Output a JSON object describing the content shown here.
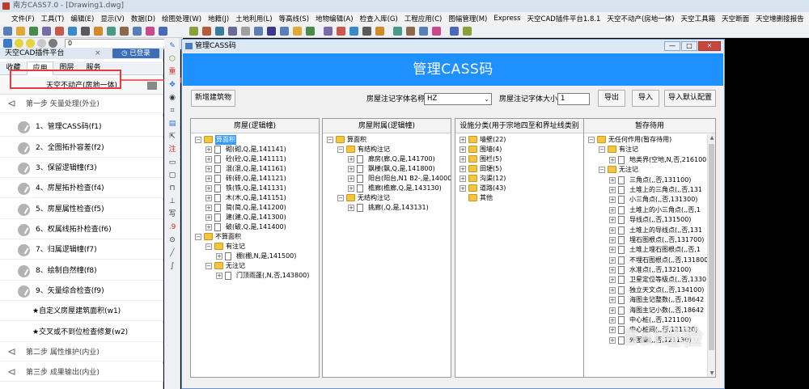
{
  "window": {
    "title": "南方CASS7.0 - [Drawing1.dwg]"
  },
  "menu": [
    "文件(F)",
    "工具(T)",
    "编辑(E)",
    "显示(V)",
    "数据(D)",
    "绘图处理(W)",
    "地籍(J)",
    "土地利用(L)",
    "等高线(S)",
    "地物编辑(A)",
    "检查入库(G)",
    "工程应用(C)",
    "图幅管理(M)",
    "Express",
    "天空CAD插件平台1.8.1",
    "天空不动产(房地一体)",
    "天空工具箱",
    "天空断面",
    "天空增删接报告"
  ],
  "toolbar2": {
    "layer_value": "0"
  },
  "left_panel": {
    "title": "天空CAD插件平台",
    "close": "×",
    "login": "已登录",
    "tabs": [
      "收藏",
      "应用",
      "图层",
      "服务"
    ],
    "active_tab": "应用",
    "subtitle": "天空不动产(房地一体)",
    "steps": [
      {
        "label": "第一步 矢量处理(外业)"
      },
      {
        "label": "第二步 属性维护(内业)"
      },
      {
        "label": "第三步 成果输出(内业)"
      }
    ],
    "items": [
      {
        "label": "1、管理CASS码(f1)"
      },
      {
        "label": "2、全图拓扑容差(f2)"
      },
      {
        "label": "3、保留逻辑幢(f3)"
      },
      {
        "label": "4、房屋拓扑检查(f4)"
      },
      {
        "label": "5、房屋属性检查(f5)"
      },
      {
        "label": "6、权属线拓扑检查(f6)"
      },
      {
        "label": "7、归属逻辑幢(f7)"
      },
      {
        "label": "8、绘制自然幢(f8)"
      },
      {
        "label": "9、矢量综合检查(f9)"
      },
      {
        "label": "★自定义房屋建筑面积(w1)"
      },
      {
        "label": "★交叉或不到位检查修复(w2)"
      }
    ]
  },
  "dialog": {
    "title": "管理CASS码",
    "banner": "管理CASS码",
    "new_building_btn": "新增建筑物",
    "font_name_label": "房屋注记字体名称:",
    "font_name_value": "HZ",
    "font_size_label": "房屋注记字体大小:",
    "font_size_value": "1",
    "export_btn": "导出",
    "import_btn": "导入",
    "import_default_btn": "导入默认配置",
    "panes": [
      {
        "header": "房屋(逻辑幢)",
        "nodes": [
          {
            "d": 0,
            "e": "−",
            "i": "folder",
            "t": "算面积",
            "sel": true
          },
          {
            "d": 1,
            "e": "+",
            "i": "doc",
            "t": "砌(砌,Q,是,141141)"
          },
          {
            "d": 1,
            "e": "+",
            "i": "doc",
            "t": "砼(砼,Q,是,141111)"
          },
          {
            "d": 1,
            "e": "+",
            "i": "doc",
            "t": "混(混,Q,是,141161)"
          },
          {
            "d": 1,
            "e": "+",
            "i": "doc",
            "t": "砖(砖,Q,是,141121)"
          },
          {
            "d": 1,
            "e": "+",
            "i": "doc",
            "t": "铁(铁,Q,是,141131)"
          },
          {
            "d": 1,
            "e": "+",
            "i": "doc",
            "t": "木(木,Q,是,141151)"
          },
          {
            "d": 1,
            "e": "+",
            "i": "doc",
            "t": "简(简,Q,是,141200)"
          },
          {
            "d": 1,
            "e": "+",
            "i": "doc",
            "t": "建(建,Q,是,141300)"
          },
          {
            "d": 1,
            "e": "+",
            "i": "doc",
            "t": "破(破,Q,是,141400)"
          },
          {
            "d": 0,
            "e": "−",
            "i": "folder",
            "t": "不算面积"
          },
          {
            "d": 1,
            "e": "−",
            "i": "folder",
            "t": "有注记"
          },
          {
            "d": 2,
            "e": "+",
            "i": "doc",
            "t": "棚(棚,N,是,141500)"
          },
          {
            "d": 1,
            "e": "−",
            "i": "folder",
            "t": "无注记"
          },
          {
            "d": 2,
            "e": "+",
            "i": "doc",
            "t": "门顶雨蓬(,N,否,143800)"
          }
        ]
      },
      {
        "header": "房屋附属(逻辑幢)",
        "nodes": [
          {
            "d": 0,
            "e": "−",
            "i": "folder",
            "t": "算面积"
          },
          {
            "d": 1,
            "e": "−",
            "i": "folder",
            "t": "有结构注记"
          },
          {
            "d": 2,
            "e": "+",
            "i": "doc",
            "t": "廊房(廊,Q,是,141700)"
          },
          {
            "d": 2,
            "e": "+",
            "i": "doc",
            "t": "飘楼(飘,Q,是,141800)"
          },
          {
            "d": 2,
            "e": "+",
            "i": "doc",
            "t": "阳台(阳台,N1 B2-,是,140001"
          },
          {
            "d": 2,
            "e": "+",
            "i": "doc",
            "t": "檐廊(檐廊,Q,是,143130)"
          },
          {
            "d": 1,
            "e": "−",
            "i": "folder",
            "t": "无结构注记"
          },
          {
            "d": 2,
            "e": "+",
            "i": "doc",
            "t": "挑廊(,Q,是,143131)"
          }
        ]
      },
      {
        "header": "设施分类(用于宗地四至和界址线类别",
        "nodes": [
          {
            "d": 0,
            "e": "+",
            "i": "folder",
            "t": "墙壁(22)"
          },
          {
            "d": 0,
            "e": "+",
            "i": "folder",
            "t": "围墙(4)"
          },
          {
            "d": 0,
            "e": "+",
            "i": "folder",
            "t": "围栏(5)"
          },
          {
            "d": 0,
            "e": "+",
            "i": "folder",
            "t": "田埂(5)"
          },
          {
            "d": 0,
            "e": "+",
            "i": "folder",
            "t": "沟渠(12)"
          },
          {
            "d": 0,
            "e": "+",
            "i": "folder",
            "t": "道路(43)"
          },
          {
            "d": 0,
            "e": "",
            "i": "folder",
            "t": "其他"
          }
        ]
      },
      {
        "header": "暂存待用",
        "nodes": [
          {
            "d": 0,
            "e": "−",
            "i": "folder",
            "t": "无任何作用(暂存待用)"
          },
          {
            "d": 1,
            "e": "−",
            "i": "folder",
            "t": "有注记"
          },
          {
            "d": 2,
            "e": "+",
            "i": "doc",
            "t": "地类界(空地,N,否,216100"
          },
          {
            "d": 1,
            "e": "−",
            "i": "folder",
            "t": "无注记"
          },
          {
            "d": 2,
            "e": "+",
            "i": "doc",
            "t": "三角点(,,否,131100)"
          },
          {
            "d": 2,
            "e": "+",
            "i": "doc",
            "t": "土堆上的三角点(,,否,131"
          },
          {
            "d": 2,
            "e": "+",
            "i": "doc",
            "t": "小三角点(,,否,131300)"
          },
          {
            "d": 2,
            "e": "+",
            "i": "doc",
            "t": "土堆上的小三角点(,,否,1"
          },
          {
            "d": 2,
            "e": "+",
            "i": "doc",
            "t": "导线点(,,否,131500)"
          },
          {
            "d": 2,
            "e": "+",
            "i": "doc",
            "t": "土堆上的导线点(,,否,131"
          },
          {
            "d": 2,
            "e": "+",
            "i": "doc",
            "t": "埋石图根点(,,否,131700)"
          },
          {
            "d": 2,
            "e": "+",
            "i": "doc",
            "t": "土堆上埋石图根点(,,否,1"
          },
          {
            "d": 2,
            "e": "+",
            "i": "doc",
            "t": "不埋石图根点(,,否,131800"
          },
          {
            "d": 2,
            "e": "+",
            "i": "doc",
            "t": "水准点(,,否,132100)"
          },
          {
            "d": 2,
            "e": "+",
            "i": "doc",
            "t": "卫星定位等级点(,,否,1330"
          },
          {
            "d": 2,
            "e": "+",
            "i": "doc",
            "t": "独立天文点(,,否,134100)"
          },
          {
            "d": 2,
            "e": "+",
            "i": "doc",
            "t": "海图主记整数(,,否,18642"
          },
          {
            "d": 2,
            "e": "+",
            "i": "doc",
            "t": "海图主记小数(,,否,18642"
          },
          {
            "d": 2,
            "e": "+",
            "i": "doc",
            "t": "中心桩(,,否,121100)"
          },
          {
            "d": 2,
            "e": "+",
            "i": "doc",
            "t": "中心桩间(,,否,121120)"
          },
          {
            "d": 2,
            "e": "+",
            "i": "doc",
            "t": "外图廓(,,否,121130)"
          }
        ]
      }
    ]
  },
  "watermark": "Bai经验"
}
